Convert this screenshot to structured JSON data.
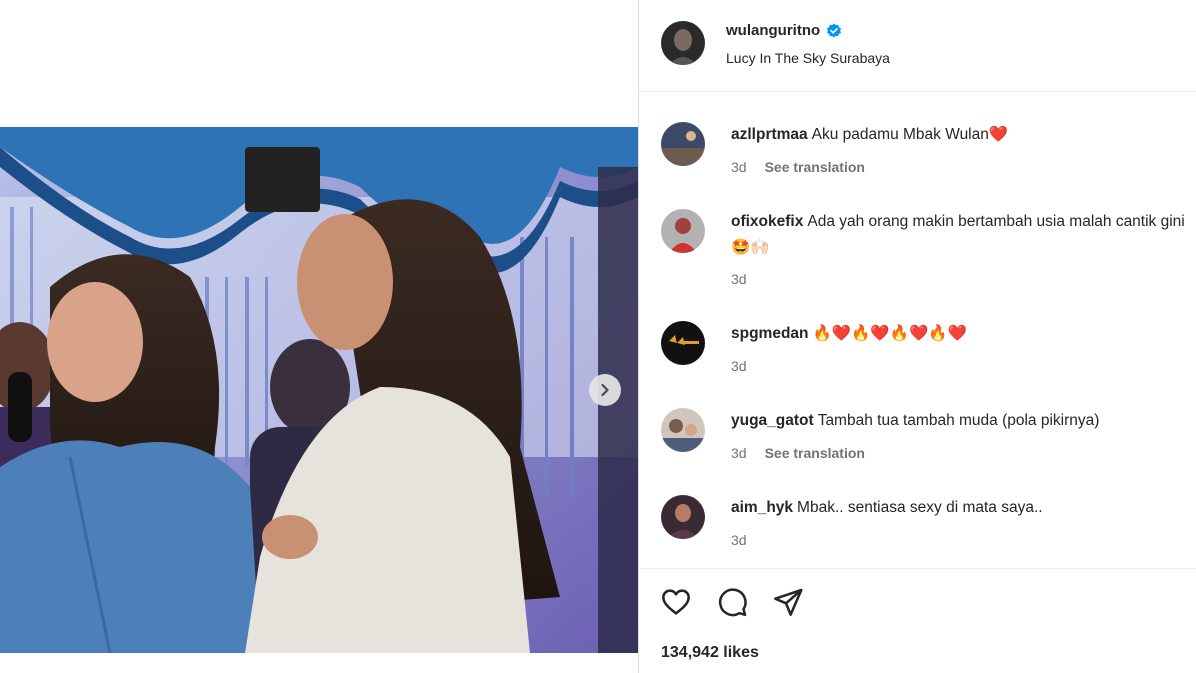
{
  "post": {
    "username": "wulanguritno",
    "location": "Lucy In The Sky Surabaya",
    "likes_text": "134,942 likes"
  },
  "comments": [
    {
      "username": "azllprtmaa",
      "text": "Aku padamu Mbak Wulan❤️",
      "time": "3d",
      "translate": "See translation"
    },
    {
      "username": "ofixokefix",
      "text": "Ada yah orang makin bertambah usia malah cantik gini🤩🙌🏻",
      "time": "3d"
    },
    {
      "username": "spgmedan",
      "text": "🔥❤️🔥❤️🔥❤️🔥❤️",
      "time": "3d"
    },
    {
      "username": "yuga_gatot",
      "text": "Tambah tua tambah muda (pola pikirnya)",
      "time": "3d",
      "translate": "See translation"
    },
    {
      "username": "aim_hyk",
      "text": "Mbak.. sentiasa sexy di mata saya..",
      "time": "3d"
    }
  ],
  "icons": {
    "verified": "verified-badge-icon",
    "next": "chevron-right-icon",
    "like": "heart-icon",
    "comment": "comment-icon",
    "share": "send-icon"
  },
  "colors": {
    "verified": "#0095f6",
    "text": "#262626",
    "meta": "#737373"
  }
}
